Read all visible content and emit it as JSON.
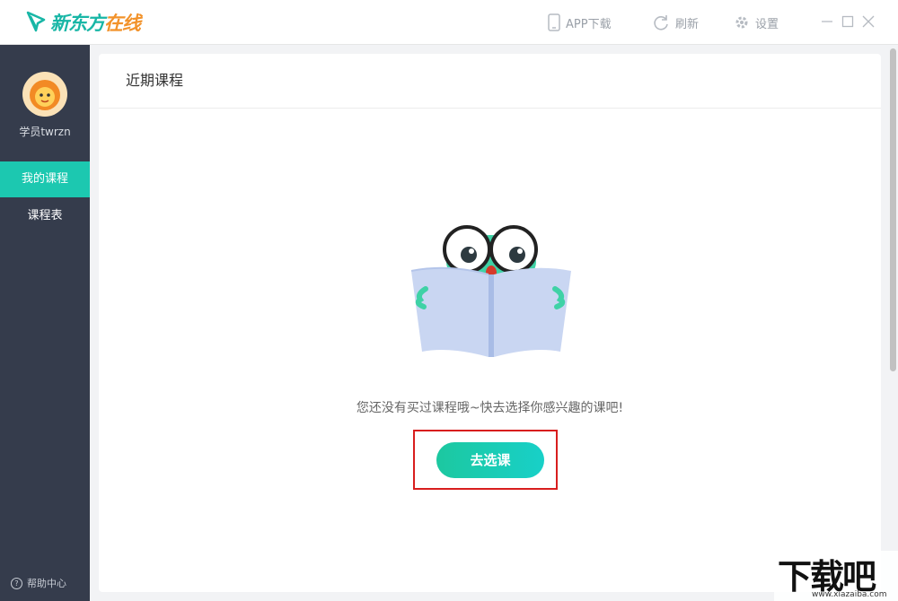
{
  "app": {
    "logo_text_main": "新东方",
    "logo_text_accent": "在线"
  },
  "toolbar": {
    "app_download_label": "APP下载",
    "refresh_label": "刷新",
    "settings_label": "设置"
  },
  "sidebar": {
    "username": "学员twrzn",
    "items": [
      {
        "label": "我的课程",
        "active": true
      },
      {
        "label": "课程表",
        "active": false
      }
    ],
    "help_label": "帮助中心"
  },
  "main": {
    "section_title": "近期课程",
    "empty_message": "您还没有买过课程哦~快去选择你感兴趣的课吧!",
    "cta_label": "去选课"
  },
  "watermark": {
    "big_text": "下载吧",
    "url_text": "www.xiazaiba.com"
  },
  "colors": {
    "accent": "#1cc8b0",
    "sidebar_bg": "#353c4c",
    "highlight_border": "#d81e1e"
  }
}
